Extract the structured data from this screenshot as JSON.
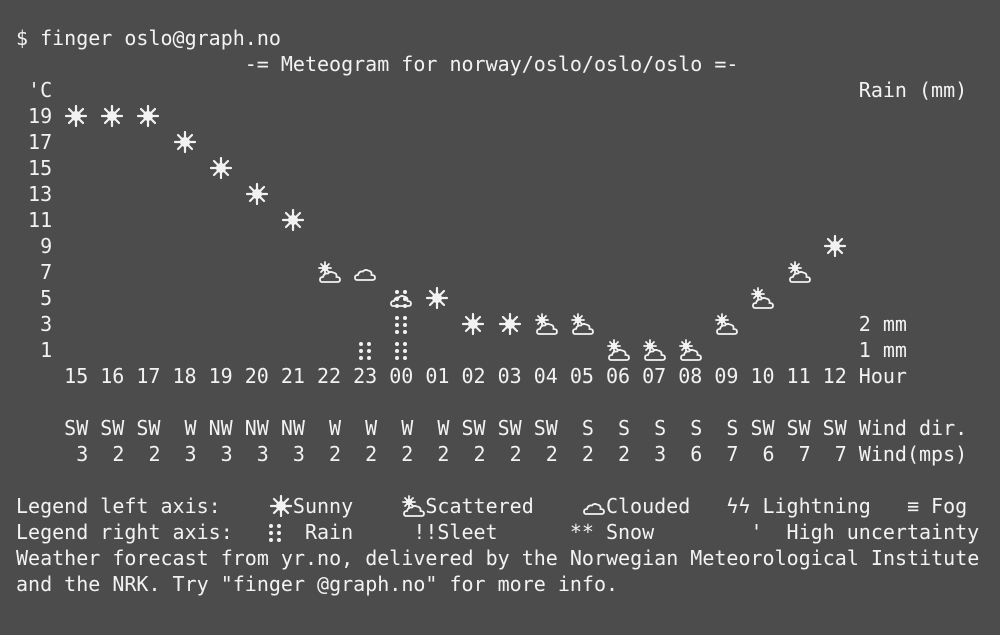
{
  "terminal": {
    "prompt": "$ finger oslo@graph.no",
    "title": "-= Meteogram for norway/oslo/oslo/oslo =-",
    "left_axis_unit": "'C",
    "right_axis_unit": "Rain (mm)",
    "hour_label": "Hour",
    "wind_dir_label": "Wind dir.",
    "wind_speed_label": "Wind(mps)"
  },
  "chart_data": {
    "type": "scatter",
    "title": "-= Meteogram for norway/oslo/oslo/oslo =-",
    "ylabel": "'C",
    "y2label": "Rain (mm)",
    "xlabel": "Hour",
    "y_ticks": [
      "19",
      "17",
      "15",
      "13",
      "11",
      "9",
      "7",
      "5",
      "3",
      "1"
    ],
    "y2_ticks": [
      "2 mm",
      "1 mm"
    ],
    "hours": [
      "15",
      "16",
      "17",
      "18",
      "19",
      "20",
      "21",
      "22",
      "23",
      "00",
      "01",
      "02",
      "03",
      "04",
      "05",
      "06",
      "07",
      "08",
      "09",
      "10",
      "11",
      "12"
    ],
    "temperature": [
      19,
      19,
      19,
      17,
      15,
      13,
      11,
      7,
      7,
      5,
      5,
      3,
      3,
      3,
      3,
      1,
      1,
      1,
      3,
      5,
      7,
      9
    ],
    "sky": [
      "sunny",
      "sunny",
      "sunny",
      "sunny",
      "sunny",
      "sunny",
      "sunny",
      "scattered",
      "clouded",
      "clouded",
      "sunny",
      "sunny",
      "sunny",
      "scattered",
      "scattered",
      "scattered",
      "scattered",
      "scattered",
      "scattered",
      "scattered",
      "scattered",
      "sunny"
    ],
    "rain_mm": [
      0,
      0,
      0,
      0,
      0,
      0,
      0,
      0,
      1,
      2,
      0,
      0,
      0,
      0,
      0,
      0,
      0,
      0,
      0,
      0,
      0,
      0
    ],
    "wind_dir": [
      "SW",
      "SW",
      "SW",
      "W",
      "NW",
      "NW",
      "NW",
      "W",
      "W",
      "W",
      "W",
      "SW",
      "SW",
      "SW",
      "S",
      "S",
      "S",
      "S",
      "S",
      "SW",
      "SW",
      "SW"
    ],
    "wind_mps": [
      "3",
      "2",
      "2",
      "3",
      "3",
      "3",
      "3",
      "2",
      "2",
      "2",
      "2",
      "2",
      "2",
      "2",
      "2",
      "2",
      "3",
      "6",
      "7",
      "6",
      "7",
      "7"
    ]
  },
  "legend": {
    "left_label": "Legend left axis:",
    "right_label": "Legend right axis:",
    "sunny": "Sunny",
    "scattered": "Scattered",
    "clouded": "Clouded",
    "lightning_glyph": "ϟϟ",
    "lightning": "Lightning",
    "fog_glyph": "≡",
    "fog": "Fog",
    "rain_glyph": "::",
    "rain": "Rain",
    "sleet_glyph": "!!",
    "sleet": "Sleet",
    "snow_glyph": "**",
    "snow": "Snow",
    "uncertainty_glyph": "'",
    "uncertainty": "High uncertainty"
  },
  "footer": {
    "line1": "Weather forecast from yr.no, delivered by the Norwegian Meteorological Institute",
    "line2": "and the NRK. Try \"finger @graph.no\" for more info."
  },
  "colors": {
    "background": "#4c4c4c",
    "text": "#f2f2f2"
  }
}
